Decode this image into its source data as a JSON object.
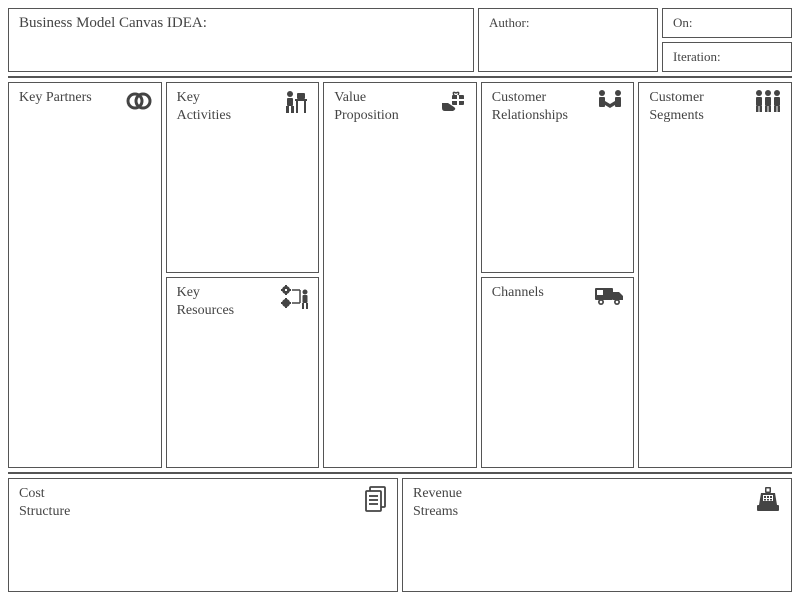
{
  "header": {
    "title_label": "Business Model Canvas IDEA:",
    "author_label": "Author:",
    "on_label": "On:",
    "iteration_label": "Iteration:"
  },
  "blocks": {
    "key_partners": {
      "label": "Key Partners",
      "icon": "rings-icon"
    },
    "key_activities": {
      "label": "Key Activities",
      "icon": "desk-worker-icon"
    },
    "key_resources": {
      "label": "Key Resources",
      "icon": "org-cogs-icon"
    },
    "value_proposition": {
      "label": "Value Proposition",
      "icon": "gift-hand-icon"
    },
    "customer_relationships": {
      "label": "Customer Relationships",
      "icon": "handshake-icon"
    },
    "channels": {
      "label": "Channels",
      "icon": "truck-icon"
    },
    "customer_segments": {
      "label": "Customer Segments",
      "icon": "people-icon"
    },
    "cost_structure": {
      "label": "Cost Structure",
      "icon": "documents-icon"
    },
    "revenue_streams": {
      "label": "Revenue Streams",
      "icon": "cash-register-icon"
    }
  }
}
